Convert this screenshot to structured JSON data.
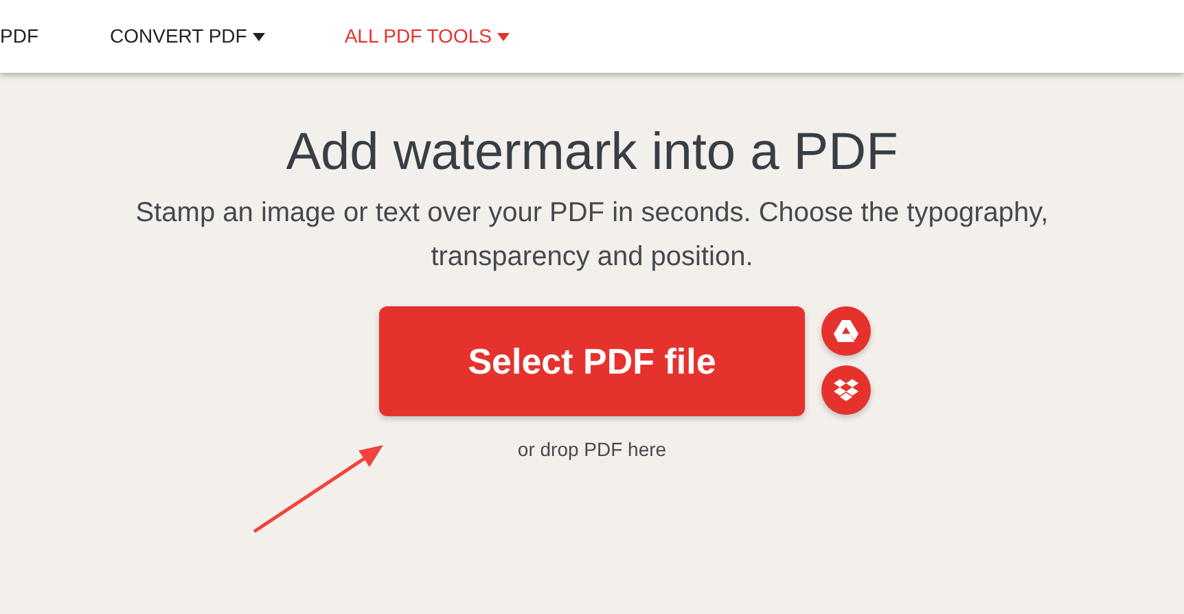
{
  "nav": [
    {
      "label": "PDF",
      "dropdown": false,
      "highlighted": false
    },
    {
      "label": "CONVERT PDF",
      "dropdown": true,
      "highlighted": false
    },
    {
      "label": "ALL PDF TOOLS",
      "dropdown": true,
      "highlighted": true
    }
  ],
  "title": "Add watermark into a PDF",
  "subtitle": "Stamp an image or text over your PDF in seconds. Choose the typography, transparency and position.",
  "select_button": "Select PDF file",
  "cloud_buttons": [
    {
      "kind": "drive"
    },
    {
      "kind": "dropbox"
    }
  ],
  "drop_hint": "or drop PDF here"
}
